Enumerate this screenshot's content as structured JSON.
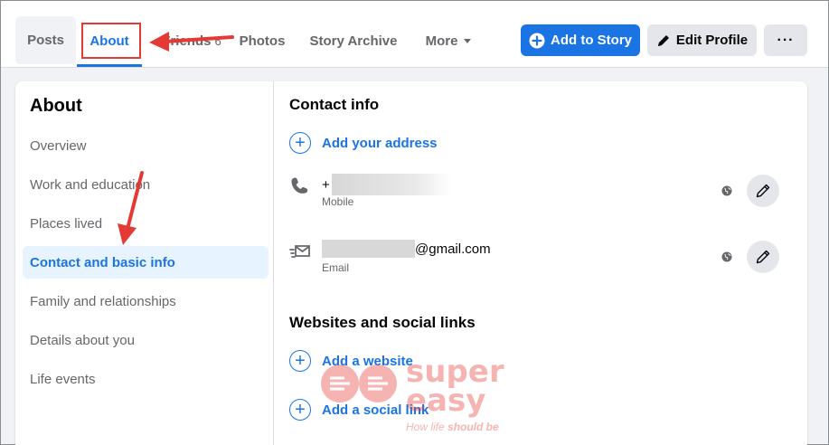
{
  "tabs": {
    "posts": "Posts",
    "about": "About",
    "friends": "Friends",
    "friends_count": "6",
    "photos": "Photos",
    "story_archive": "Story Archive",
    "more": "More"
  },
  "actions": {
    "add_to_story": "Add to Story",
    "edit_profile": "Edit Profile",
    "more_options": "···"
  },
  "about_nav": {
    "title": "About",
    "items": [
      {
        "label": "Overview"
      },
      {
        "label": "Work and education"
      },
      {
        "label": "Places lived"
      },
      {
        "label": "Contact and basic info",
        "active": true
      },
      {
        "label": "Family and relationships"
      },
      {
        "label": "Details about you"
      },
      {
        "label": "Life events"
      }
    ]
  },
  "contact_info": {
    "title": "Contact info",
    "add_address": "Add your address",
    "phone": {
      "value": "+",
      "type": "Mobile"
    },
    "email": {
      "value": "@gmail.com",
      "type": "Email"
    }
  },
  "websites": {
    "title": "Websites and social links",
    "add_website": "Add a website",
    "add_social": "Add a social link"
  },
  "watermark": {
    "line1": "super",
    "line2": "easy",
    "tagline_prefix": "How life ",
    "tagline_emph": "should be"
  },
  "colors": {
    "accent": "#1b74e4",
    "annotation": "#e53935",
    "secondary_text": "#65676b",
    "button_gray": "#e4e6eb"
  }
}
